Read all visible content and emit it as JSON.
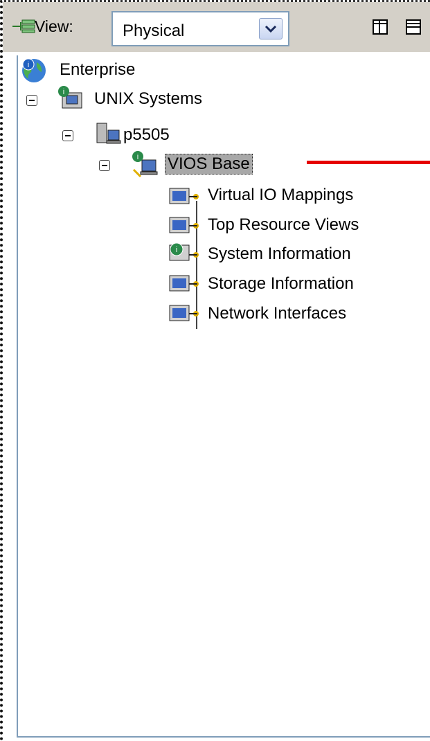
{
  "toolbar": {
    "view_label": "View:",
    "view_select_value": "Physical"
  },
  "tree": {
    "enterprise": "Enterprise",
    "unix_systems": "UNIX Systems",
    "host": "p5505",
    "vios": "VIOS Base",
    "children": [
      "Virtual IO Mappings",
      "Top Resource Views",
      "System Information",
      "Storage Information",
      "Network Interfaces"
    ]
  },
  "colors": {
    "selection": "#a8a8a8",
    "annotation_arrow": "#e60000",
    "toolbar_bg": "#d4d0c8"
  }
}
